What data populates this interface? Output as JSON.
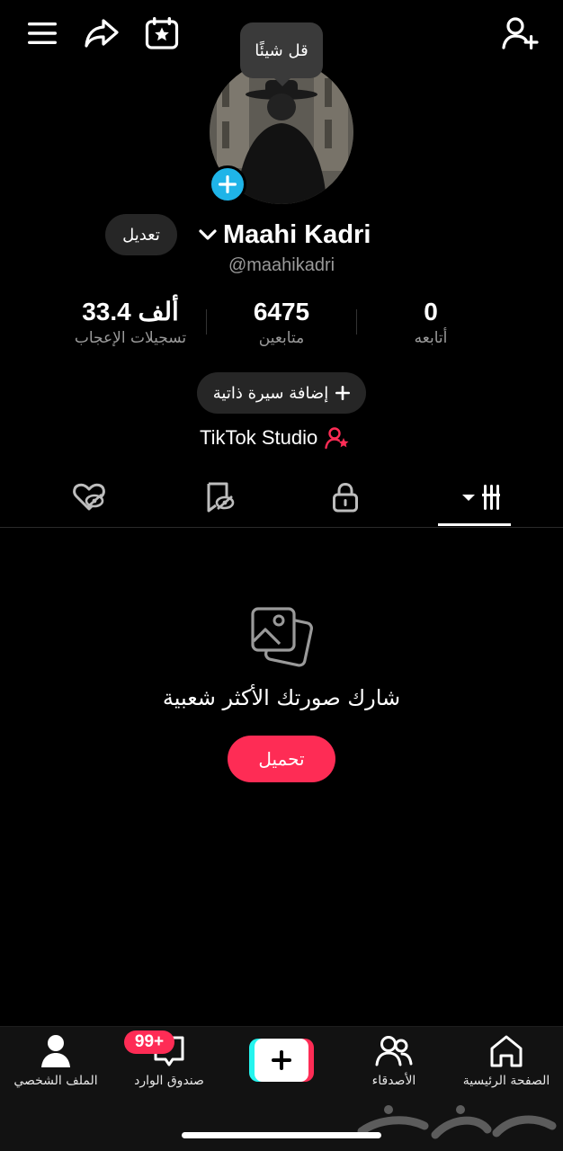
{
  "header": {
    "tooltip": "قل شيئًا",
    "edit_label": "تعديل",
    "display_name": "Maahi Kadri",
    "username": "@maahikadri"
  },
  "stats": [
    {
      "value": "33.4 ألف",
      "label": "تسجيلات الإعجاب"
    },
    {
      "value": "6475",
      "label": "متابعين"
    },
    {
      "value": "0",
      "label": "أتابعه"
    }
  ],
  "bio_button": "إضافة سيرة ذاتية",
  "studio_label": "TikTok Studio",
  "empty_state": {
    "title": "شارك صورتك الأكثر شعبية",
    "upload_label": "تحميل"
  },
  "nav": {
    "profile": "الملف الشخصي",
    "inbox": "صندوق الوارد",
    "inbox_badge": "99+",
    "friends": "الأصدقاء",
    "home": "الصفحة الرئيسية"
  },
  "colors": {
    "accent": "#fe2c55",
    "cyan": "#25f4ee",
    "avatar_badge": "#1fb4e8",
    "background": "#000000"
  },
  "icons": [
    "menu-icon",
    "share-icon",
    "calendar-star-icon",
    "add-friend-icon",
    "liked-hidden-icon",
    "favorites-hidden-icon",
    "lock-icon",
    "grid-icon",
    "photos-icon",
    "home-icon",
    "friends-icon",
    "plus-icon",
    "inbox-icon",
    "profile-icon"
  ]
}
